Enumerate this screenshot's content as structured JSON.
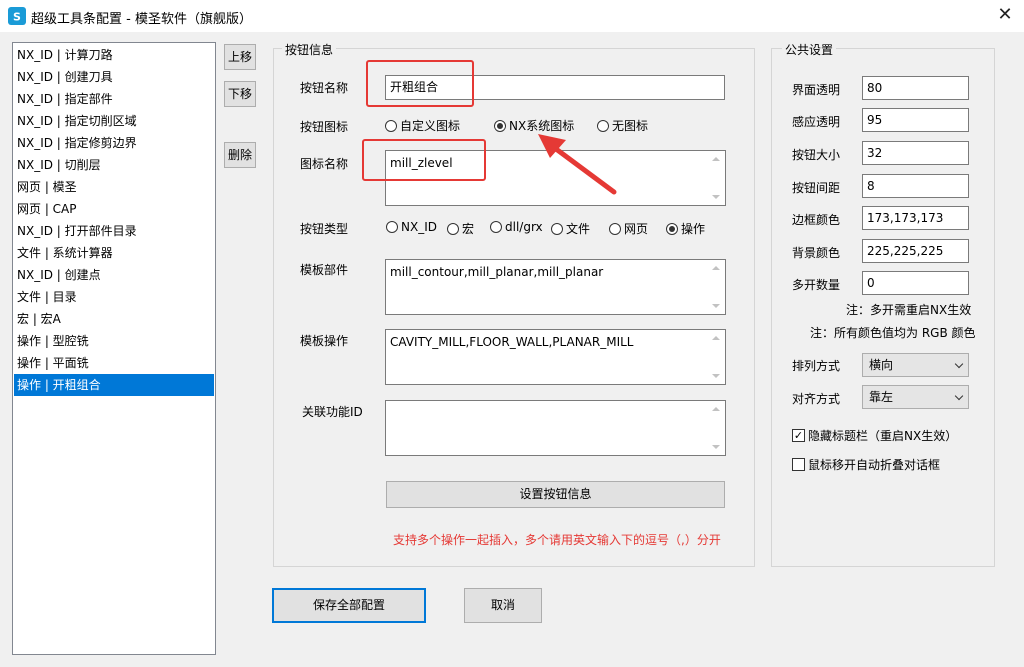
{
  "window": {
    "title": "超级工具条配置 - 模圣软件（旗舰版）",
    "close_glyph": "✕"
  },
  "list": {
    "items": [
      "NX_ID | 计算刀路",
      "NX_ID | 创建刀具",
      "NX_ID | 指定部件",
      "NX_ID | 指定切削区域",
      "NX_ID | 指定修剪边界",
      "NX_ID | 切削层",
      "网页 | 模圣",
      "网页 | CAP",
      "NX_ID | 打开部件目录",
      "文件 | 系统计算器",
      "NX_ID | 创建点",
      "文件 | 目录",
      "宏 | 宏A",
      "操作 | 型腔铣",
      "操作 | 平面铣",
      "操作 | 开粗组合"
    ],
    "selected_index": 15
  },
  "side_buttons": {
    "up": "上移",
    "down": "下移",
    "delete": "删除"
  },
  "button_info": {
    "legend": "按钮信息",
    "name_label": "按钮名称",
    "name_value": "开粗组合",
    "icon_label": "按钮图标",
    "icon_options": [
      "自定义图标",
      "NX系统图标",
      "无图标"
    ],
    "icon_selected": "NX系统图标",
    "icon_name_label": "图标名称",
    "icon_name_value": "mill_zlevel",
    "type_label": "按钮类型",
    "type_options": [
      "NX_ID",
      "宏",
      "dll/grx",
      "文件",
      "网页",
      "操作"
    ],
    "type_selected": "操作",
    "template_part_label": "模板部件",
    "template_part_value": "mill_contour,mill_planar,mill_planar",
    "template_op_label": "模板操作",
    "template_op_value": "CAVITY_MILL,FLOOR_WALL,PLANAR_MILL",
    "related_id_label": "关联功能ID",
    "related_id_value": "",
    "set_button": "设置按钮信息",
    "hint": "支持多个操作一起插入，多个请用英文输入下的逗号（,）分开",
    "hint_color": "#e53935"
  },
  "common": {
    "legend": "公共设置",
    "fields": [
      {
        "label": "界面透明",
        "value": "80"
      },
      {
        "label": "感应透明",
        "value": "95"
      },
      {
        "label": "按钮大小",
        "value": "32"
      },
      {
        "label": "按钮间距",
        "value": "8"
      },
      {
        "label": "边框颜色",
        "value": "173,173,173"
      },
      {
        "label": "背景颜色",
        "value": "225,225,225"
      },
      {
        "label": "多开数量",
        "value": "0"
      }
    ],
    "note1": "注：多开需重启NX生效",
    "note2": "注：所有颜色值均为 RGB 颜色",
    "arrange_label": "排列方式",
    "arrange_value": "横向",
    "align_label": "对齐方式",
    "align_value": "靠左",
    "hide_titlebar": {
      "label": "隐藏标题栏（重启NX生效）",
      "checked": true
    },
    "auto_fold": {
      "label": "鼠标移开自动折叠对话框",
      "checked": false
    }
  },
  "footer": {
    "save_all": "保存全部配置",
    "cancel": "取消"
  },
  "annotation": {
    "color": "#e53935",
    "check_glyph": "✓"
  }
}
